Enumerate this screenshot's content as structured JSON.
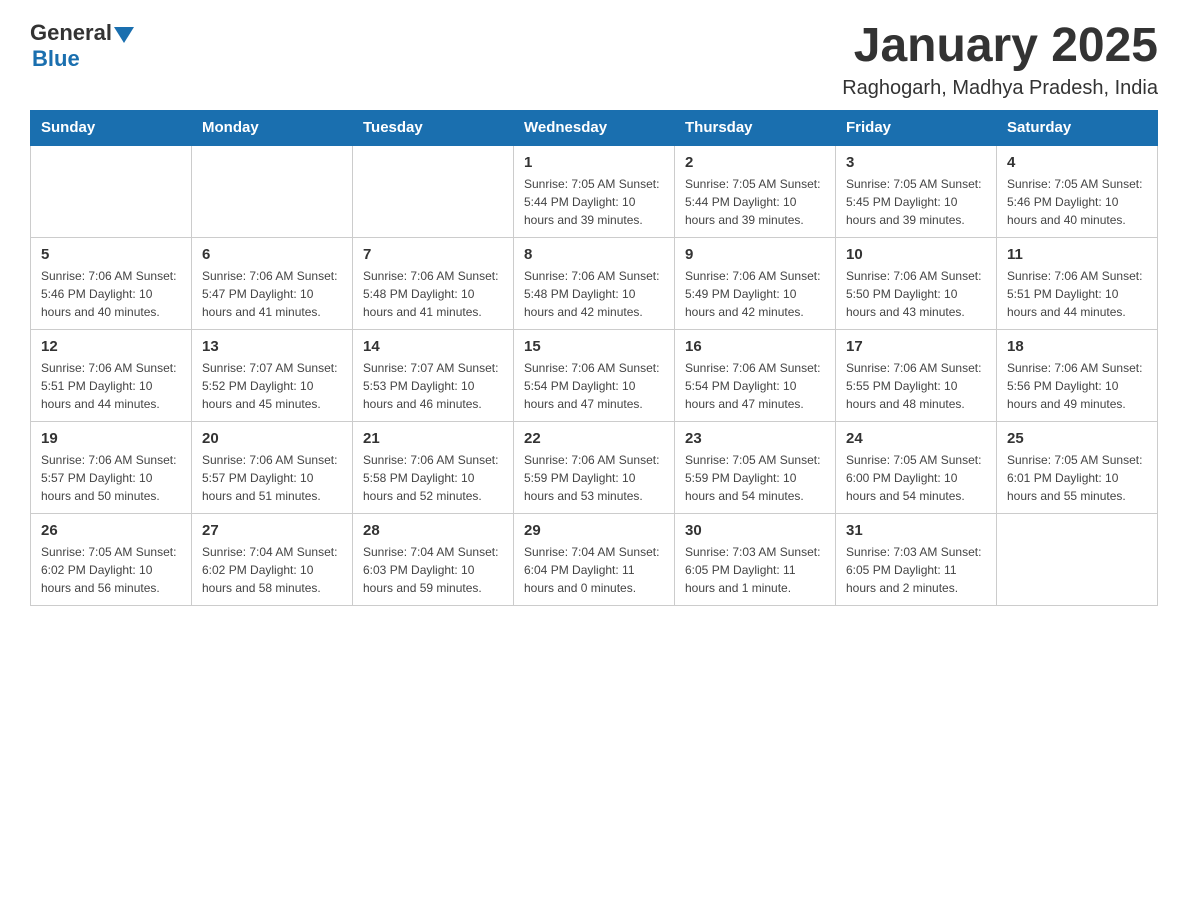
{
  "header": {
    "logo_general": "General",
    "logo_blue": "Blue",
    "month_title": "January 2025",
    "location": "Raghogarh, Madhya Pradesh, India"
  },
  "days_of_week": [
    "Sunday",
    "Monday",
    "Tuesday",
    "Wednesday",
    "Thursday",
    "Friday",
    "Saturday"
  ],
  "weeks": [
    [
      {
        "day": "",
        "info": ""
      },
      {
        "day": "",
        "info": ""
      },
      {
        "day": "",
        "info": ""
      },
      {
        "day": "1",
        "info": "Sunrise: 7:05 AM\nSunset: 5:44 PM\nDaylight: 10 hours\nand 39 minutes."
      },
      {
        "day": "2",
        "info": "Sunrise: 7:05 AM\nSunset: 5:44 PM\nDaylight: 10 hours\nand 39 minutes."
      },
      {
        "day": "3",
        "info": "Sunrise: 7:05 AM\nSunset: 5:45 PM\nDaylight: 10 hours\nand 39 minutes."
      },
      {
        "day": "4",
        "info": "Sunrise: 7:05 AM\nSunset: 5:46 PM\nDaylight: 10 hours\nand 40 minutes."
      }
    ],
    [
      {
        "day": "5",
        "info": "Sunrise: 7:06 AM\nSunset: 5:46 PM\nDaylight: 10 hours\nand 40 minutes."
      },
      {
        "day": "6",
        "info": "Sunrise: 7:06 AM\nSunset: 5:47 PM\nDaylight: 10 hours\nand 41 minutes."
      },
      {
        "day": "7",
        "info": "Sunrise: 7:06 AM\nSunset: 5:48 PM\nDaylight: 10 hours\nand 41 minutes."
      },
      {
        "day": "8",
        "info": "Sunrise: 7:06 AM\nSunset: 5:48 PM\nDaylight: 10 hours\nand 42 minutes."
      },
      {
        "day": "9",
        "info": "Sunrise: 7:06 AM\nSunset: 5:49 PM\nDaylight: 10 hours\nand 42 minutes."
      },
      {
        "day": "10",
        "info": "Sunrise: 7:06 AM\nSunset: 5:50 PM\nDaylight: 10 hours\nand 43 minutes."
      },
      {
        "day": "11",
        "info": "Sunrise: 7:06 AM\nSunset: 5:51 PM\nDaylight: 10 hours\nand 44 minutes."
      }
    ],
    [
      {
        "day": "12",
        "info": "Sunrise: 7:06 AM\nSunset: 5:51 PM\nDaylight: 10 hours\nand 44 minutes."
      },
      {
        "day": "13",
        "info": "Sunrise: 7:07 AM\nSunset: 5:52 PM\nDaylight: 10 hours\nand 45 minutes."
      },
      {
        "day": "14",
        "info": "Sunrise: 7:07 AM\nSunset: 5:53 PM\nDaylight: 10 hours\nand 46 minutes."
      },
      {
        "day": "15",
        "info": "Sunrise: 7:06 AM\nSunset: 5:54 PM\nDaylight: 10 hours\nand 47 minutes."
      },
      {
        "day": "16",
        "info": "Sunrise: 7:06 AM\nSunset: 5:54 PM\nDaylight: 10 hours\nand 47 minutes."
      },
      {
        "day": "17",
        "info": "Sunrise: 7:06 AM\nSunset: 5:55 PM\nDaylight: 10 hours\nand 48 minutes."
      },
      {
        "day": "18",
        "info": "Sunrise: 7:06 AM\nSunset: 5:56 PM\nDaylight: 10 hours\nand 49 minutes."
      }
    ],
    [
      {
        "day": "19",
        "info": "Sunrise: 7:06 AM\nSunset: 5:57 PM\nDaylight: 10 hours\nand 50 minutes."
      },
      {
        "day": "20",
        "info": "Sunrise: 7:06 AM\nSunset: 5:57 PM\nDaylight: 10 hours\nand 51 minutes."
      },
      {
        "day": "21",
        "info": "Sunrise: 7:06 AM\nSunset: 5:58 PM\nDaylight: 10 hours\nand 52 minutes."
      },
      {
        "day": "22",
        "info": "Sunrise: 7:06 AM\nSunset: 5:59 PM\nDaylight: 10 hours\nand 53 minutes."
      },
      {
        "day": "23",
        "info": "Sunrise: 7:05 AM\nSunset: 5:59 PM\nDaylight: 10 hours\nand 54 minutes."
      },
      {
        "day": "24",
        "info": "Sunrise: 7:05 AM\nSunset: 6:00 PM\nDaylight: 10 hours\nand 54 minutes."
      },
      {
        "day": "25",
        "info": "Sunrise: 7:05 AM\nSunset: 6:01 PM\nDaylight: 10 hours\nand 55 minutes."
      }
    ],
    [
      {
        "day": "26",
        "info": "Sunrise: 7:05 AM\nSunset: 6:02 PM\nDaylight: 10 hours\nand 56 minutes."
      },
      {
        "day": "27",
        "info": "Sunrise: 7:04 AM\nSunset: 6:02 PM\nDaylight: 10 hours\nand 58 minutes."
      },
      {
        "day": "28",
        "info": "Sunrise: 7:04 AM\nSunset: 6:03 PM\nDaylight: 10 hours\nand 59 minutes."
      },
      {
        "day": "29",
        "info": "Sunrise: 7:04 AM\nSunset: 6:04 PM\nDaylight: 11 hours\nand 0 minutes."
      },
      {
        "day": "30",
        "info": "Sunrise: 7:03 AM\nSunset: 6:05 PM\nDaylight: 11 hours\nand 1 minute."
      },
      {
        "day": "31",
        "info": "Sunrise: 7:03 AM\nSunset: 6:05 PM\nDaylight: 11 hours\nand 2 minutes."
      },
      {
        "day": "",
        "info": ""
      }
    ]
  ]
}
